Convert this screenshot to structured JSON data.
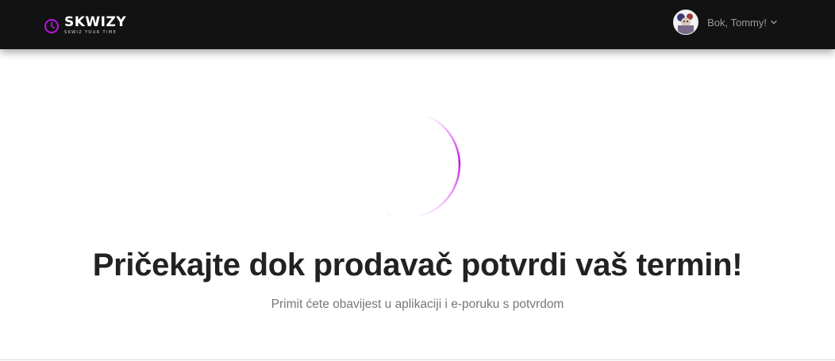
{
  "header": {
    "logo_name": "SKWIZY",
    "logo_tagline": "SKWIZ YOUR TIME",
    "greeting": "Bok, Tommy!"
  },
  "main": {
    "headline": "Pričekajte dok prodavač potvrdi vaš termin!",
    "subtext": "Primit ćete obavijest u aplikaciji i e-poruku s potvrdom"
  },
  "colors": {
    "header_bg": "#121212",
    "brand_accent": "#b812e3",
    "spinner": "#c40fe8"
  },
  "icons": {
    "logo": "clock-icon",
    "avatar": "user-avatar",
    "menu": "chevron-down-icon",
    "loading": "loading-spinner-icon"
  }
}
